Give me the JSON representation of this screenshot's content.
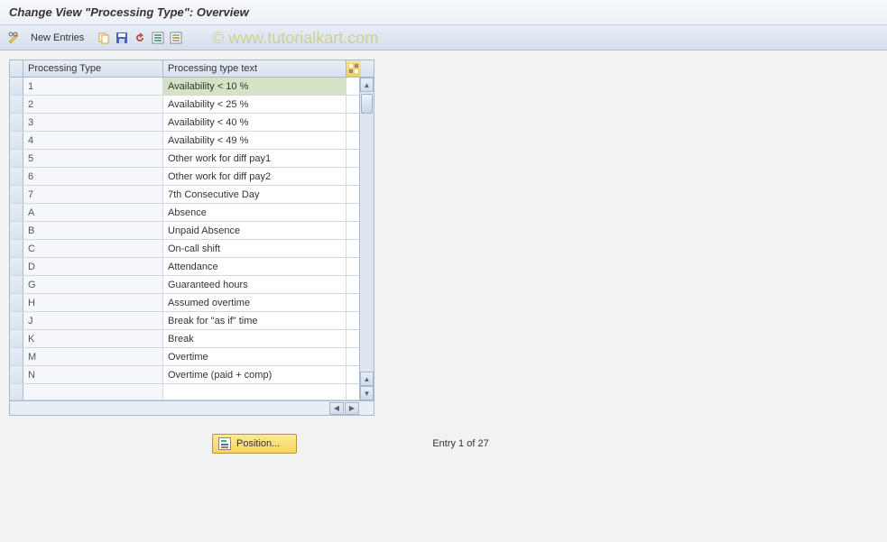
{
  "title": "Change View \"Processing Type\": Overview",
  "toolbar": {
    "new_entries": "New Entries"
  },
  "watermark": "© www.tutorialkart.com",
  "columns": {
    "type": "Processing Type",
    "text": "Processing type text"
  },
  "rows": [
    {
      "type": "1",
      "text": "Availability < 10 %",
      "hl": true
    },
    {
      "type": "2",
      "text": "Availability < 25 %"
    },
    {
      "type": "3",
      "text": "Availability < 40 %"
    },
    {
      "type": "4",
      "text": "Availability < 49 %"
    },
    {
      "type": "5",
      "text": "Other work for diff pay1"
    },
    {
      "type": "6",
      "text": "Other work for diff pay2"
    },
    {
      "type": "7",
      "text": "7th Consecutive Day"
    },
    {
      "type": "A",
      "text": "Absence"
    },
    {
      "type": "B",
      "text": "Unpaid Absence"
    },
    {
      "type": "C",
      "text": "On-call shift"
    },
    {
      "type": "D",
      "text": "Attendance"
    },
    {
      "type": "G",
      "text": "Guaranteed hours"
    },
    {
      "type": "H",
      "text": "Assumed overtime"
    },
    {
      "type": "J",
      "text": "Break for \"as if\" time"
    },
    {
      "type": "K",
      "text": "Break"
    },
    {
      "type": "M",
      "text": "Overtime"
    },
    {
      "type": "N",
      "text": "Overtime (paid + comp)"
    }
  ],
  "footer": {
    "position_label": "Position...",
    "entry_text": "Entry 1 of 27"
  }
}
